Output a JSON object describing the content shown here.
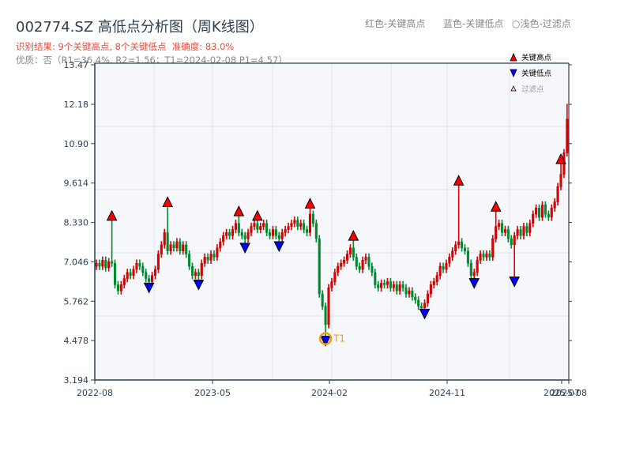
{
  "header": {
    "title": "002774.SZ 高低点分析图（周K线图）",
    "result": "识别结果: 9个关键高点, 8个关键低点  准确度: 83.0%",
    "quality": "优质：否（R1=36.4%, R2=1.56；T1=2024-02-08 P1=4.57）",
    "hint_red": "红色-关键高点",
    "hint_blue": "蓝色-关键低点",
    "hint_light": "○浅色-过滤点"
  },
  "colors": {
    "up": "#e00000",
    "down": "#008a30",
    "high_marker": "#ff0000",
    "low_marker": "#0000ff",
    "t1": "#f39c12",
    "plot_bg": "#f5f7fa",
    "axis": "#2c3e50"
  },
  "chart_data": {
    "type": "candlestick",
    "title": "002774.SZ 高低点分析图（周K线图）",
    "ylim": [
      3.194,
      13.47
    ],
    "y_ticks": [
      "13.47",
      "12.18",
      "10.90",
      "9.614",
      "8.330",
      "7.046",
      "5.762",
      "4.478",
      "3.194"
    ],
    "x_ticks": [
      "2022-08",
      "2023-05",
      "2024-02",
      "2024-11",
      "2025-07",
      "2025-08"
    ],
    "grid": true,
    "legend": {
      "position": "top-right",
      "items": [
        "关键高点",
        "关键低点",
        "过滤点"
      ]
    },
    "close": [
      7.0,
      6.9,
      7.1,
      6.85,
      7.05,
      7.0,
      6.3,
      6.1,
      6.3,
      6.5,
      6.7,
      6.6,
      6.8,
      7.0,
      6.9,
      6.7,
      6.5,
      6.4,
      6.6,
      6.8,
      7.3,
      7.6,
      8.0,
      7.4,
      7.6,
      7.5,
      7.7,
      7.4,
      7.6,
      7.3,
      6.9,
      6.6,
      6.7,
      6.6,
      7.0,
      7.2,
      7.1,
      7.3,
      7.2,
      7.5,
      7.7,
      7.9,
      8.0,
      7.9,
      8.1,
      8.3,
      8.0,
      7.9,
      7.8,
      8.0,
      8.2,
      8.3,
      8.1,
      8.2,
      8.3,
      8.0,
      7.9,
      8.1,
      7.9,
      7.8,
      8.0,
      8.1,
      8.2,
      8.3,
      8.4,
      8.2,
      8.3,
      8.1,
      8.0,
      8.6,
      8.3,
      7.8,
      6.0,
      5.6,
      5.0,
      6.2,
      6.4,
      6.7,
      6.9,
      7.0,
      7.1,
      7.3,
      7.5,
      7.2,
      6.9,
      6.8,
      7.1,
      7.2,
      6.9,
      6.7,
      6.3,
      6.2,
      6.35,
      6.3,
      6.4,
      6.2,
      6.3,
      6.1,
      6.3,
      6.2,
      6.0,
      6.1,
      5.9,
      5.8,
      5.6,
      5.55,
      5.7,
      6.0,
      6.3,
      6.4,
      6.6,
      6.9,
      6.8,
      7.0,
      7.2,
      7.4,
      7.6,
      7.7,
      7.5,
      7.4,
      7.0,
      6.6,
      6.7,
      7.1,
      7.3,
      7.2,
      7.3,
      7.2,
      7.8,
      8.2,
      8.3,
      8.0,
      8.1,
      7.8,
      7.6,
      7.9,
      8.1,
      7.9,
      8.2,
      8.0,
      8.3,
      8.6,
      8.8,
      8.5,
      8.9,
      8.6,
      8.5,
      8.8,
      9.0,
      9.5,
      9.9,
      10.6,
      11.7
    ],
    "key_highs": [
      {
        "week": 5,
        "price": 8.45
      },
      {
        "week": 23,
        "price": 8.9
      },
      {
        "week": 46,
        "price": 8.6
      },
      {
        "week": 52,
        "price": 8.45
      },
      {
        "week": 69,
        "price": 8.85
      },
      {
        "week": 83,
        "price": 7.8
      },
      {
        "week": 117,
        "price": 9.6
      },
      {
        "week": 129,
        "price": 8.75
      },
      {
        "week": 150,
        "price": 10.3
      }
    ],
    "key_lows": [
      {
        "week": 17,
        "price": 6.3
      },
      {
        "week": 33,
        "price": 6.4
      },
      {
        "week": 48,
        "price": 7.6
      },
      {
        "week": 59,
        "price": 7.65
      },
      {
        "week": 74,
        "price": 4.57
      },
      {
        "week": 106,
        "price": 5.45
      },
      {
        "week": 122,
        "price": 6.45
      },
      {
        "week": 135,
        "price": 6.5
      }
    ],
    "last_high": 12.2,
    "annotation": {
      "label": "T1",
      "week": 74,
      "price": 4.57
    }
  }
}
